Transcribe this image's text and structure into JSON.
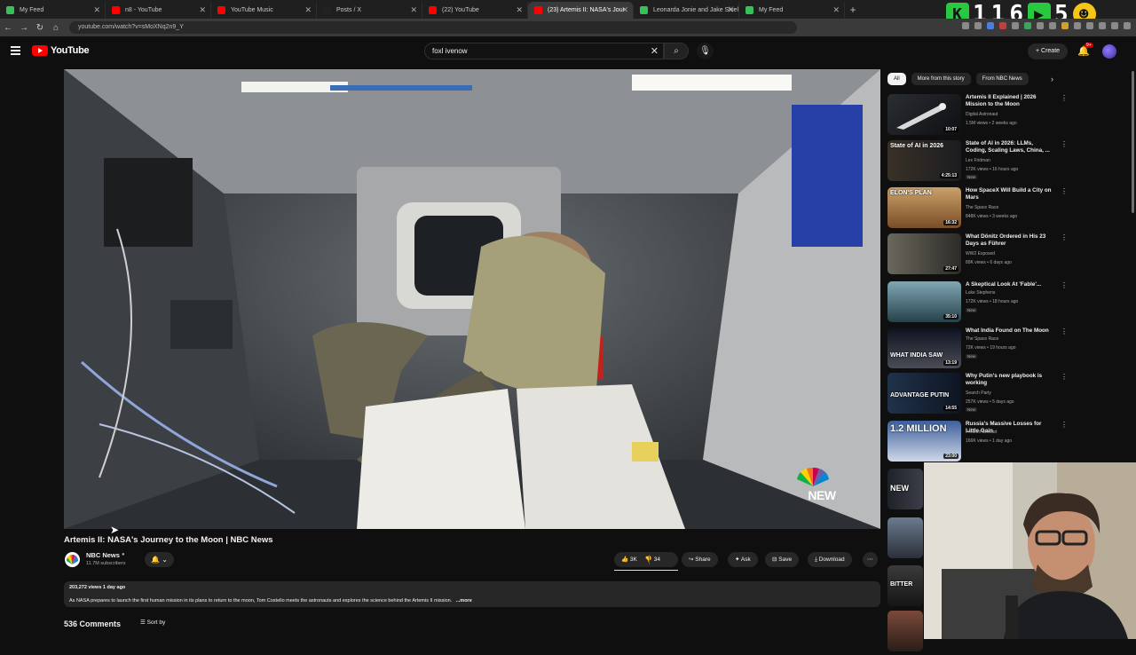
{
  "browser": {
    "tabs": [
      {
        "title": "My Feed",
        "color": "#36c25a"
      },
      {
        "title": "n8 - YouTube",
        "color": "#ff0000"
      },
      {
        "title": "YouTube Music",
        "color": "#ff0000"
      },
      {
        "title": "Posts / X",
        "color": "#222222"
      },
      {
        "title": "(22) YouTube",
        "color": "#ff0000"
      },
      {
        "title": "(23) Artemis II: NASA's Jour",
        "color": "#ff0000"
      },
      {
        "title": "Leonarda Jonie and Jake Shiel",
        "color": "#36c25a"
      },
      {
        "title": "My Feed",
        "color": "#36c25a"
      }
    ],
    "active_tab": 5,
    "url": "youtube.com/watch?v=sMoXNq2n9_Y",
    "overlay_digits": [
      "1",
      "1",
      "6",
      "5"
    ]
  },
  "header": {
    "logo_text": "YouTube",
    "search_value": "foxl ivenow",
    "create_label": "+ Create",
    "notif_badge": "9+"
  },
  "video": {
    "title": "Artemis II: NASA's Journey to the Moon | NBC News",
    "channel": "NBC News",
    "subscribers": "11.7M subscribers",
    "bug_text": "NEW",
    "actions": {
      "like": "3K",
      "dislike": "34",
      "share": "Share",
      "ask": "Ask",
      "save": "Save",
      "download": "Download"
    },
    "stats": "203,272 views  1 day ago",
    "description": "As NASA prepares to launch the first human mission in its plans to return to the moon, Tom Costello meets the astronauts and explores the science behind the Artemis II mission.",
    "more_label": "...more",
    "comments_count": "536 Comments",
    "sort_label": "Sort by"
  },
  "chips": [
    "All",
    "More from this story",
    "From NBC News"
  ],
  "recommendations": [
    {
      "title": "Artemis II Explained | 2026 Mission to the Moon",
      "channel": "Digital Astronaut",
      "meta": "1.5M views • 2 weeks ago",
      "duration": "10:07",
      "thumb_label": "",
      "new": "",
      "bg": "#202225"
    },
    {
      "title": "State of AI in 2026: LLMs, Coding, Scaling Laws, China, ...",
      "channel": "Lex Fridman",
      "meta": "172K views • 16 hours ago",
      "duration": "4:25:13",
      "thumb_label": "State of AI in 2026",
      "new": "New",
      "bg": "#1c1e22"
    },
    {
      "title": "How SpaceX Will Build a City on Mars",
      "channel": "The Space Race",
      "meta": "848K views • 3 weeks ago",
      "duration": "16:32",
      "thumb_label": "ELON'S PLAN",
      "new": "",
      "bg": "#9b6a3a"
    },
    {
      "title": "What Dönitz Ordered in His 23 Days as Führer",
      "channel": "WW2 Exposed",
      "meta": "89K views • 6 days ago",
      "duration": "27:47",
      "thumb_label": "",
      "new": "",
      "bg": "#4a4840"
    },
    {
      "title": "A Skeptical Look At 'Fable'...",
      "channel": "Luke Stephens",
      "meta": "172K views • 18 hours ago",
      "duration": "35:10",
      "thumb_label": "",
      "new": "New",
      "bg": "#35505a"
    },
    {
      "title": "What India Found on The Moon",
      "channel": "The Space Race",
      "meta": "72K views • 19 hours ago",
      "duration": "13:19",
      "thumb_label": "WHAT INDIA SAW",
      "new": "New",
      "bg": "#1a2030"
    },
    {
      "title": "Why Putin's new playbook is working",
      "channel": "Search Party",
      "meta": "257K views • 5 days ago",
      "duration": "14:55",
      "thumb_label": "ADVANTAGE PUTIN",
      "new": "New",
      "bg": "#1e2c3c"
    },
    {
      "title": "Russia's Massive Losses for Little Gain",
      "channel": "Preston Stewart",
      "meta": "166K views • 1 day ago",
      "duration": "23:00",
      "thumb_label": "1.2 MILLION",
      "new": "",
      "bg": "#2f4a7a"
    }
  ],
  "partial_thumbs": [
    "NEW",
    "",
    "BITTER"
  ]
}
